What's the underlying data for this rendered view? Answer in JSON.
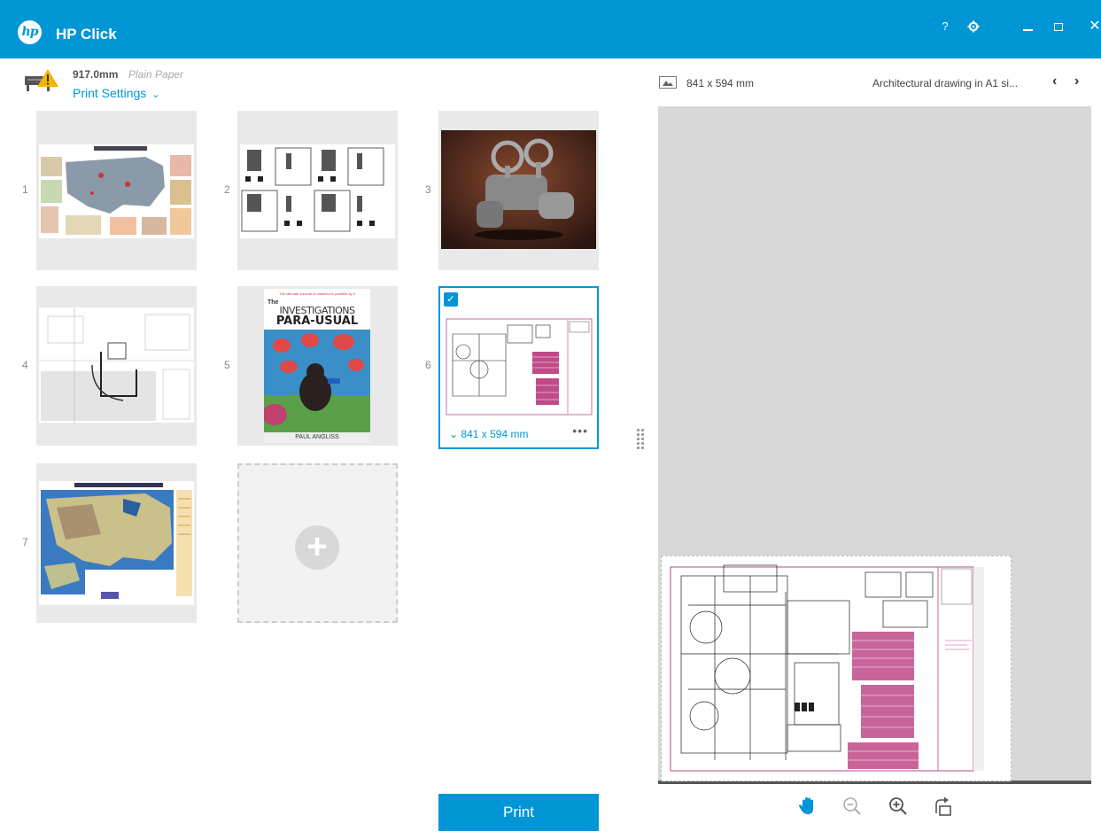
{
  "app": {
    "title": "HP Click",
    "logo_text": "hp"
  },
  "window_controls": {
    "help": "?",
    "close": "✕"
  },
  "printer": {
    "paper_width": "917.0mm",
    "paper_type": "Plain Paper",
    "settings_label": "Print Settings"
  },
  "thumbnails": [
    {
      "index": "1"
    },
    {
      "index": "2"
    },
    {
      "index": "3"
    },
    {
      "index": "4"
    },
    {
      "index": "5",
      "book_tagline": "The ultimate survival of mankind is possible by it",
      "book_title_small": "The",
      "book_title_line1": "INVESTIGATIONS",
      "book_title_line2": "PARA-USUAL",
      "book_author": "PAUL ANGLISS"
    },
    {
      "index": "6",
      "selected": true,
      "page_size": "841 x 594 mm"
    },
    {
      "index": "7"
    }
  ],
  "add_item": {
    "icon": "plus-icon"
  },
  "preview": {
    "dims": "841 x 594 mm",
    "title": "Architectural drawing in A1 si..."
  },
  "actions": {
    "print_label": "Print"
  },
  "colors": {
    "accent": "#0096d6",
    "preview_bg": "#d8d8d8",
    "thumb_bg": "#e9e9e9"
  }
}
